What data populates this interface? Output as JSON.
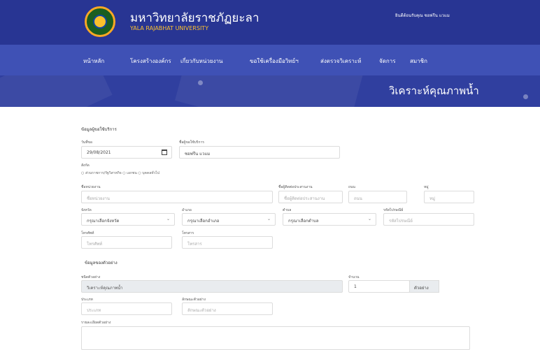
{
  "header": {
    "university_th": "มหาวิทยาลัยราชภัฏยะลา",
    "university_en": "YALA RAJABHAT UNIVERSITY",
    "welcome": "ยินดีต้อนรับคุณ ซอฟรีน แวแม"
  },
  "nav": {
    "items": [
      {
        "label": "หน้าหลัก"
      },
      {
        "label": "โครงสร้างองค์กร"
      },
      {
        "label": "เกี่ยวกับหน่วยงาน"
      },
      {
        "label": "ขอใช้เครื่องมือวิทย์ฯ"
      },
      {
        "label": "ส่งตรวจวิเคราะห์"
      },
      {
        "label": "จัดการ"
      },
      {
        "label": "สมาชิก"
      }
    ]
  },
  "banner": {
    "title": "วิเคราะห์คุณภาพน้ำ"
  },
  "form": {
    "requester_section": "ข้อมูลผู้ขอใช้บริการ",
    "date": {
      "label": "วันที่ขอ",
      "value": "29/08/2021"
    },
    "name": {
      "label": "ชื่อผู้ขอใช้บริการ",
      "value": "ซอฟรีน แวแม"
    },
    "status": {
      "label": "สังกัด",
      "options": [
        "ส่วนราชการ/รัฐวิสาหกิจ",
        "เอกชน",
        "บุคคลทั่วไป"
      ]
    },
    "agency": {
      "label": "ชื่อหน่วยงาน",
      "placeholder": "ชื่อหน่วยงาน"
    },
    "tax_id": {
      "label": "ชื่อผู้ติดต่อประสานงาน",
      "placeholder": "ชื่อผู้ติดต่อประสานงาน"
    },
    "address": {
      "label": "ถนน",
      "placeholder": "ถนน"
    },
    "moo": {
      "label": "หมู่",
      "placeholder": "หมู่"
    },
    "province": {
      "label": "จังหวัด",
      "value": "กรุณาเลือกจังหวัด"
    },
    "district": {
      "label": "อำเภอ",
      "value": "กรุณาเลือกอำเภอ"
    },
    "subdistrict": {
      "label": "ตำบล",
      "value": "กรุณาเลือกตำบล"
    },
    "postcode": {
      "label": "รหัสไปรษณีย์",
      "placeholder": "รหัสไปรษณีย์"
    },
    "phone": {
      "label": "โทรศัพท์",
      "placeholder": "โทรศัพท์"
    },
    "fax": {
      "label": "โทรสาร",
      "placeholder": "โทรสาร"
    },
    "sample_section": "ข้อมูลของตัวอย่าง",
    "sample_type": {
      "label": "ชนิดตัวอย่าง",
      "value": "วิเคราะห์คุณภาพน้ำ"
    },
    "quantity": {
      "label": "จำนวน",
      "value": "1",
      "unit": "ตัวอย่าง"
    },
    "sample_kind": {
      "label": "ประเภท",
      "placeholder": "ประเภท"
    },
    "sample_char": {
      "label": "ลักษณะตัวอย่าง",
      "placeholder": "ลักษณะตัวอย่าง"
    },
    "description": {
      "label": "รายละเอียดตัวอย่าง"
    }
  }
}
